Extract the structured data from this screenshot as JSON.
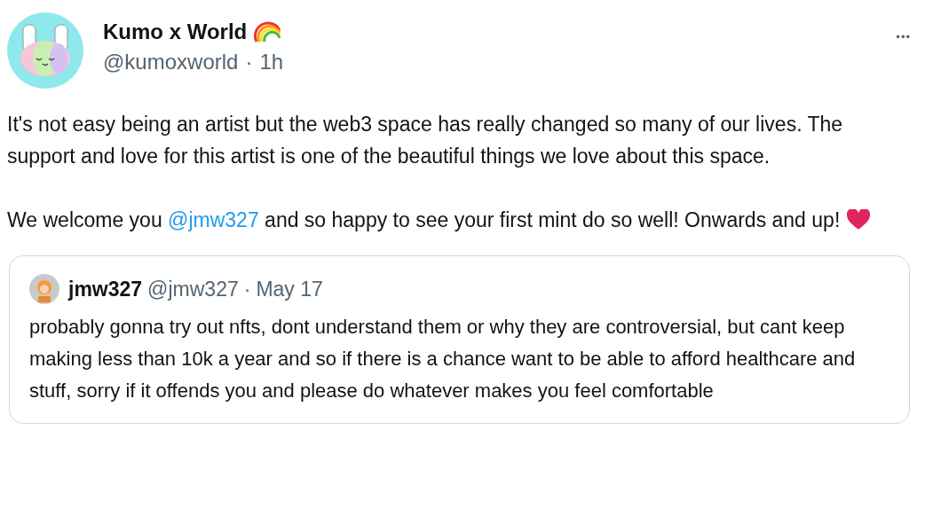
{
  "tweet": {
    "author": {
      "name": "Kumo x World",
      "handle": "@kumoxworld",
      "separator": "·",
      "time": "1h"
    },
    "more_menu": "•••",
    "paragraphs": [
      {
        "parts": [
          {
            "kind": "text",
            "text": "It's not easy being an artist but the web3 space has really changed so many of our lives. The support and love for this artist is one of the beautiful things we love about this space."
          }
        ]
      },
      {
        "parts": [
          {
            "kind": "text",
            "text": "We welcome you "
          },
          {
            "kind": "mention",
            "text": "@jmw327"
          },
          {
            "kind": "text",
            "text": " and so happy to see your first mint do so well! Onwards and up!"
          },
          {
            "kind": "heart"
          }
        ]
      }
    ],
    "quoted_tweet": {
      "author": {
        "name": "jmw327",
        "handle": "@jmw327",
        "separator": "·",
        "time": "May 17"
      },
      "text": "probably gonna try out nfts, dont understand them or why they are controversial, but cant keep making less than 10k a year and so if there is a chance want to be able to afford healthcare and stuff, sorry if it offends you and please do whatever makes you feel comfortable"
    }
  }
}
